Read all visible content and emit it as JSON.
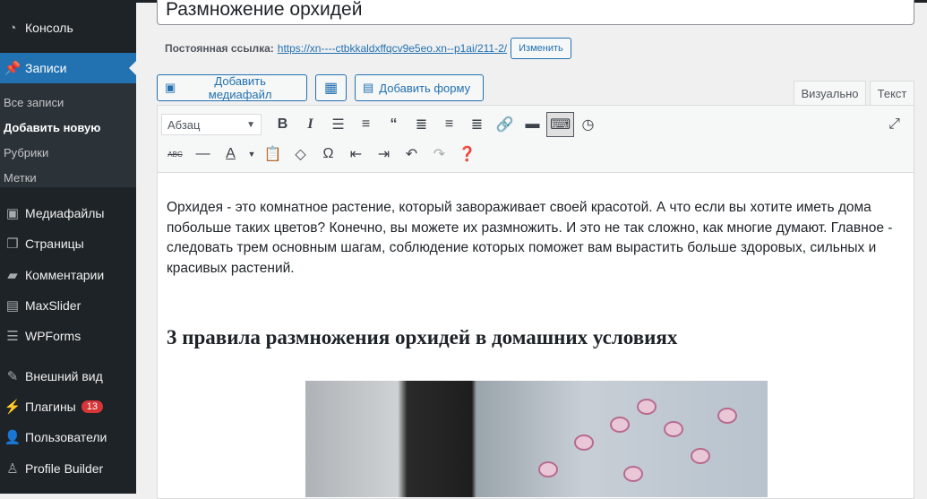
{
  "sidebar": {
    "items": [
      {
        "label": "Консоль",
        "icon": "dashboard-icon"
      },
      {
        "label": "Записи",
        "icon": "pin-icon"
      },
      {
        "label": "Медиафайлы",
        "icon": "media-icon"
      },
      {
        "label": "Страницы",
        "icon": "pages-icon"
      },
      {
        "label": "Комментарии",
        "icon": "comment-icon"
      },
      {
        "label": "MaxSlider",
        "icon": "slider-icon"
      },
      {
        "label": "WPForms",
        "icon": "forms-icon"
      },
      {
        "label": "Внешний вид",
        "icon": "brush-icon"
      },
      {
        "label": "Плагины",
        "icon": "plugin-icon",
        "badge": "13"
      },
      {
        "label": "Пользователи",
        "icon": "user-icon"
      },
      {
        "label": "Profile Builder",
        "icon": "profile-icon"
      }
    ],
    "submenu": [
      "Все записи",
      "Добавить новую",
      "Рубрики",
      "Метки"
    ]
  },
  "title": "Размножение орхидей",
  "permalink": {
    "label": "Постоянная ссылка:",
    "url": "https://xn----ctbkkaldxffqcv9e5eo.xn--p1ai/211-2/",
    "edit": "Изменить"
  },
  "media": {
    "add_media": "Добавить медиафайл",
    "add_form": "Добавить форму"
  },
  "tabs": {
    "visual": "Визуально",
    "text": "Текст"
  },
  "toolbar": {
    "format": "Абзац"
  },
  "content": {
    "paragraph": "Орхидея - это комнатное растение, который завораживает своей красотой. А что если вы хотите иметь дома побольше таких цветов? Конечно, вы можете их размножить. И это не так сложно, как многие думают. Главное - следовать трем основным шагам, соблюдение которых поможет вам вырастить больше здоровых, сильных и красивых растений.",
    "heading": "3 правила размножения орхидей в домашних условиях"
  }
}
